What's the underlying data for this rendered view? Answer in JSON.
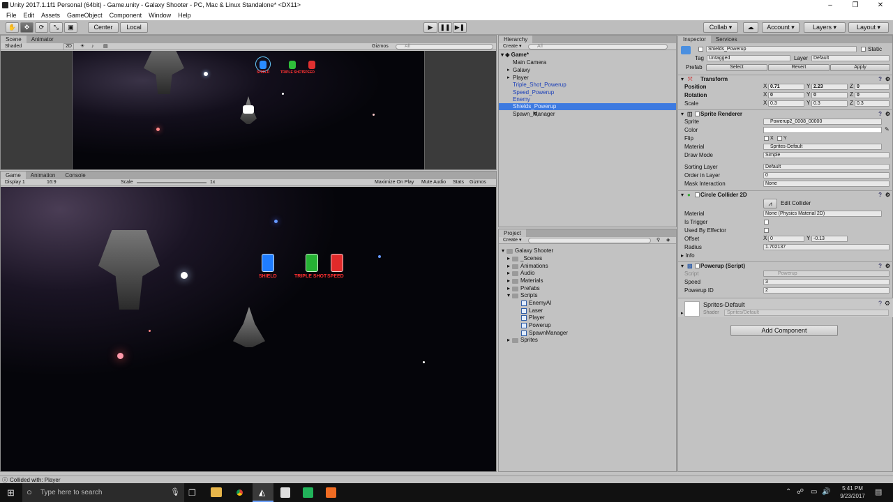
{
  "window": {
    "title": "Unity 2017.1.1f1 Personal (64bit) - Game.unity - Galaxy Shooter - PC, Mac & Linux Standalone* <DX11>",
    "controls": [
      "–",
      "❐",
      "✕"
    ]
  },
  "menu": [
    "File",
    "Edit",
    "Assets",
    "GameObject",
    "Component",
    "Window",
    "Help"
  ],
  "toolbar": {
    "pivot": "Center",
    "space": "Local",
    "collab": "Collab ▾",
    "account": "Account",
    "layers": "Layers",
    "layout": "Layout"
  },
  "scene": {
    "tabs": [
      "Scene",
      "Animator"
    ],
    "shading": "Shaded",
    "mode_2d": "2D",
    "gizmos": "Gizmos",
    "search_placeholder": "All",
    "powerup_labels": [
      "SHIELD",
      "TRIPLE SHOT",
      "SPEED"
    ]
  },
  "game": {
    "tabs": [
      "Game",
      "Animation",
      "Console"
    ],
    "display": "Display 1",
    "aspect": "16:9",
    "scale_label": "Scale",
    "scale_value": "1x",
    "options": [
      "Maximize On Play",
      "Mute Audio",
      "Stats",
      "Gizmos"
    ],
    "labels": [
      "SHIELD",
      "TRIPLE SHOT",
      "SPEED"
    ]
  },
  "hierarchy": {
    "tab": "Hierarchy",
    "create": "Create ▾",
    "search_placeholder": "All",
    "scene_name": "Game*",
    "items": [
      "Main Camera",
      "Galaxy",
      "Player",
      "Triple_Shot_Powerup",
      "Speed_Powerup",
      "Enemy",
      "Shields_Powerup",
      "Spawn_Manager"
    ],
    "selected": "Shields_Powerup"
  },
  "project": {
    "tab": "Project",
    "create": "Create ▾",
    "root": "Galaxy Shooter",
    "folders": [
      "_Scenes",
      "Animations",
      "Audio",
      "Materials",
      "Prefabs",
      "Scripts"
    ],
    "scripts": [
      "EnemyAI",
      "Laser",
      "Player",
      "Powerup",
      "SpawnManager"
    ],
    "last_folder": "Sprites"
  },
  "inspector": {
    "tabs": [
      "Inspector",
      "Services"
    ],
    "object_name": "Shields_Powerup",
    "static_label": "Static",
    "tag_label": "Tag",
    "tag_value": "Untagged",
    "layer_label": "Layer",
    "layer_value": "Default",
    "prefab_label": "Prefab",
    "prefab_buttons": [
      "Select",
      "Revert",
      "Apply"
    ],
    "transform": {
      "header": "Transform",
      "position_label": "Position",
      "rotation_label": "Rotation",
      "scale_label": "Scale",
      "position": [
        "0.71",
        "2.23",
        "0"
      ],
      "rotation": [
        "0",
        "0",
        "0"
      ],
      "scale": [
        "0.3",
        "0.3",
        "0.3"
      ]
    },
    "sprite_renderer": {
      "header": "Sprite Renderer",
      "sprite_label": "Sprite",
      "sprite": "Powerup2_0008_00000",
      "color_label": "Color",
      "flip_label": "Flip",
      "material_label": "Material",
      "material": "Sprites-Default",
      "draw_mode_label": "Draw Mode",
      "draw_mode": "Simple",
      "sorting_layer_label": "Sorting Layer",
      "sorting_layer": "Default",
      "order_label": "Order in Layer",
      "order": "0",
      "mask_label": "Mask Interaction",
      "mask": "None"
    },
    "circle_collider": {
      "header": "Circle Collider 2D",
      "edit_collider": "Edit Collider",
      "material_label": "Material",
      "material": "None (Physics Material 2D)",
      "trigger_label": "Is Trigger",
      "effector_label": "Used By Effector",
      "offset_label": "Offset",
      "offset": [
        "0",
        "-0.13"
      ],
      "radius_label": "Radius",
      "radius": "1.702137",
      "info_label": "Info"
    },
    "powerup_script": {
      "header": "Powerup (Script)",
      "script_label": "Script",
      "script": "Powerup",
      "speed_label": "Speed",
      "speed": "3",
      "id_label": "Powerup ID",
      "id": "2"
    },
    "material_block": {
      "name": "Sprites-Default",
      "shader_label": "Shader",
      "shader": "Sprites/Default"
    },
    "add_component": "Add Component"
  },
  "status": "Collided with: Player",
  "taskbar": {
    "search_placeholder": "Type here to search",
    "time": "5:41 PM",
    "date": "9/23/2017"
  },
  "colors": {
    "selection": "#3d7ae0",
    "link_blue": "#1b3fb8",
    "panel": "#c2c2c2"
  }
}
